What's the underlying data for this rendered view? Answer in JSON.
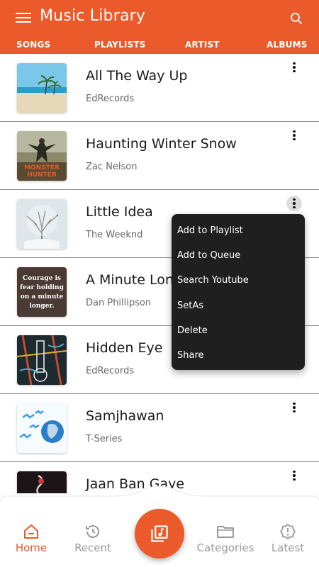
{
  "app": {
    "title": "Music Library",
    "accent_color": "#EA5A2A",
    "tabs": [
      "SONGS",
      "PLAYLISTS",
      "ARTIST",
      "ALBUMS"
    ]
  },
  "songs": [
    {
      "title": "All The Way Up",
      "artist": "EdRecords",
      "art": "beach-icon"
    },
    {
      "title": "Haunting Winter Snow",
      "artist": "Zac Nelson",
      "art": "monster-hunter-icon",
      "art_text": "MONSTER HUNTER"
    },
    {
      "title": "Little Idea",
      "artist": "The Weeknd",
      "art": "snow-tree-icon"
    },
    {
      "title": "A Minute Long",
      "artist": "Dan Phillipson",
      "art": "quote-icon",
      "art_text": [
        "Courage is",
        "fear holding",
        "on a minute",
        "longer."
      ]
    },
    {
      "title": "Hidden Eye",
      "artist": "EdRecords",
      "art": "abstract-guitar-icon"
    },
    {
      "title": "Samjhawan",
      "artist": "T-Series",
      "art": "birds-silhouette-icon"
    },
    {
      "title": "Jaan Ban Gaye",
      "artist": "",
      "art": "dark-cover-icon"
    }
  ],
  "context_menu": {
    "items": [
      "Add to Playlist",
      "Add to Queue",
      "Search Youtube",
      "SetAs",
      "Delete",
      "Share"
    ]
  },
  "bottom_nav": {
    "items": [
      {
        "label": "Home",
        "icon": "home-icon",
        "active": true
      },
      {
        "label": "Recent",
        "icon": "history-icon",
        "active": false
      },
      {
        "label": "Categories",
        "icon": "folder-icon",
        "active": false
      },
      {
        "label": "Latest",
        "icon": "badge-alert-icon",
        "active": false
      }
    ],
    "center_icon": "music-library-icon"
  }
}
